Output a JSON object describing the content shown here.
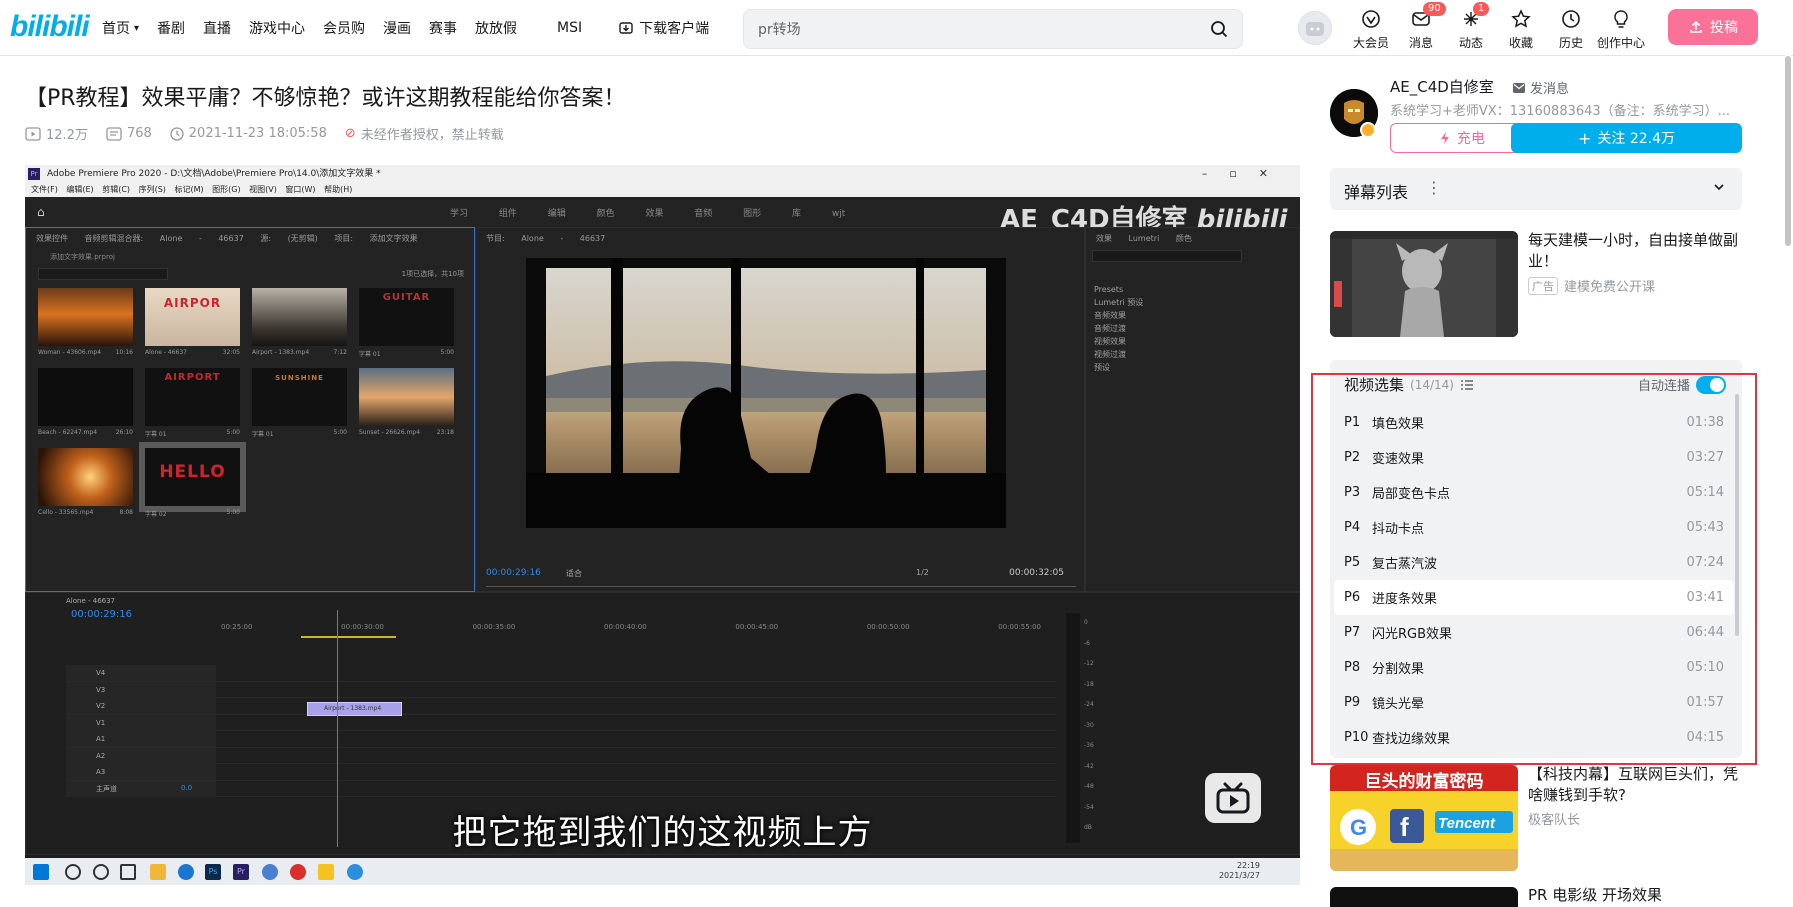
{
  "header": {
    "logo": "bilibili",
    "nav": [
      {
        "label": "首页",
        "has_chevron": true
      },
      {
        "label": "番剧"
      },
      {
        "label": "直播"
      },
      {
        "label": "游戏中心"
      },
      {
        "label": "会员购"
      },
      {
        "label": "漫画"
      },
      {
        "label": "赛事"
      },
      {
        "label": "放放假"
      },
      {
        "label": "MSI"
      }
    ],
    "download": "下载客户端",
    "search_value": "pr转场",
    "icons": [
      {
        "label": "大会员",
        "icon": "vip-icon"
      },
      {
        "label": "消息",
        "icon": "message-icon",
        "badge": "90"
      },
      {
        "label": "动态",
        "icon": "dynamic-icon",
        "badge": "1"
      },
      {
        "label": "收藏",
        "icon": "star-icon"
      },
      {
        "label": "历史",
        "icon": "clock-icon"
      },
      {
        "label": "创作中心",
        "icon": "bulb-icon"
      }
    ],
    "upload": "投稿"
  },
  "video": {
    "title": "【PR教程】效果平庸？不够惊艳？或许这期教程能给你答案！",
    "views": "12.2万",
    "danmaku_count": "768",
    "date": "2021-11-23 18:05:58",
    "copyright": "未经作者授权，禁止转载"
  },
  "player": {
    "app_title": "Adobe Premiere Pro 2020 - D:\\文档\\Adobe\\Premiere Pro\\14.0\\添加文字效果 *",
    "menu": "文件(F) 编辑(E) 剪辑(C) 序列(S) 标记(M) 图形(G) 视图(V) 窗口(W) 帮助(H)",
    "workspace_tabs": "学习 组件 编辑 颜色 效果 音频 图形 库 wjt",
    "watermark": "AE_C4D自修室",
    "watermark_logo": "bilibili",
    "project_panel_head": "效果控件 音频剪辑混合器: Alone - 46637 源: (无剪辑) 项目: 添加文字效果",
    "project_file": "添加文字效果.prproj",
    "selection_info": "1项已选择，共10项",
    "thumbs": [
      {
        "name": "Woman - 43606.mp4",
        "dur": "10:16",
        "text": ""
      },
      {
        "name": "Alone - 46637",
        "dur": "32:05",
        "text": "AIRPOR"
      },
      {
        "name": "Airport - 1383.mp4",
        "dur": "7:12",
        "text": ""
      },
      {
        "name": "字幕 01",
        "dur": "5:00",
        "text": "GUITAR"
      },
      {
        "name": "Beach - 62247.mp4",
        "dur": "26:10",
        "text": ""
      },
      {
        "name": "字幕 01",
        "dur": "5:00",
        "text": "AIRPORT"
      },
      {
        "name": "字幕 01",
        "dur": "5:00",
        "text": "SUNSHINE"
      },
      {
        "name": "Sunset - 26626.mp4",
        "dur": "23:18",
        "text": ""
      },
      {
        "name": "Cello - 33565.mp4",
        "dur": "8:08",
        "text": ""
      },
      {
        "name": "字幕 02",
        "dur": "5:00",
        "text": "HELLO"
      }
    ],
    "program_label": "节目: Alone - 46637",
    "timecode_in": "00:00:29:16",
    "fit": "适合",
    "quality": "1/2",
    "timecode_out": "00:00:32:05",
    "effects_tabs": "效果 Lumetri 颜色",
    "effects_list": [
      "Presets",
      "Lumetri 预设",
      "音频效果",
      "音频过渡",
      "视频效果",
      "视频过渡",
      "预设"
    ],
    "sequence_name": "Alone - 46637",
    "sequence_tc": "00:00:29:16",
    "ruler": [
      "00:25:00",
      "00:00:30:00",
      "00:00:35:00",
      "00:00:40:00",
      "00:00:45:00",
      "00:00:50:00",
      "00:00:55:00"
    ],
    "track_names": [
      "V4",
      "V3",
      "V2",
      "V1",
      "A1",
      "A2",
      "A3",
      "主声道"
    ],
    "master_value": "0.0",
    "clip_label": "Airport - 1383.mp4",
    "meter_scale": [
      "0",
      "-6",
      "-12",
      "-18",
      "-24",
      "-30",
      "-36",
      "-42",
      "-48",
      "-54",
      "dB"
    ],
    "subtitle": "把它拖到我们的这视频上方",
    "clock": "22:19",
    "clock_date": "2021/3/27"
  },
  "uploader": {
    "name": "AE_C4D自修室",
    "message": "发消息",
    "desc": "系统学习+老师VX：13160883643（备注：系统学习）...",
    "charge": "充电",
    "follow": "关注 22.4万"
  },
  "danmaku_list": {
    "title": "弹幕列表"
  },
  "ad": {
    "title": "每天建模一小时，自由接单做副业！",
    "tag": "广告",
    "source": "建模免费公开课"
  },
  "playlist": {
    "title": "视频选集",
    "count": "(14/14)",
    "autoplay": "自动连播",
    "items": [
      {
        "p": "P1",
        "name": "填色效果",
        "dur": "01:38"
      },
      {
        "p": "P2",
        "name": "变速效果",
        "dur": "03:27"
      },
      {
        "p": "P3",
        "name": "局部变色卡点",
        "dur": "05:14"
      },
      {
        "p": "P4",
        "name": "抖动卡点",
        "dur": "05:43"
      },
      {
        "p": "P5",
        "name": "复古蒸汽波",
        "dur": "07:24"
      },
      {
        "p": "P6",
        "name": "进度条效果",
        "dur": "03:41",
        "active": true
      },
      {
        "p": "P7",
        "name": "闪光RGB效果",
        "dur": "06:44"
      },
      {
        "p": "P8",
        "name": "分割效果",
        "dur": "05:10"
      },
      {
        "p": "P9",
        "name": "镜头光晕",
        "dur": "01:57"
      },
      {
        "p": "P10",
        "name": "查找边缘效果",
        "dur": "04:15"
      }
    ]
  },
  "recommend": [
    {
      "title": "【科技内幕】互联网巨头们，凭啥赚钱到手软?",
      "author": "极客队长",
      "thumb_text": "巨头的财富密码"
    },
    {
      "title": "PR 电影级 开场效果"
    }
  ],
  "colors": {
    "brand": "#00aeec",
    "pink": "#fb7299",
    "highlight_box": "#e8323c"
  }
}
